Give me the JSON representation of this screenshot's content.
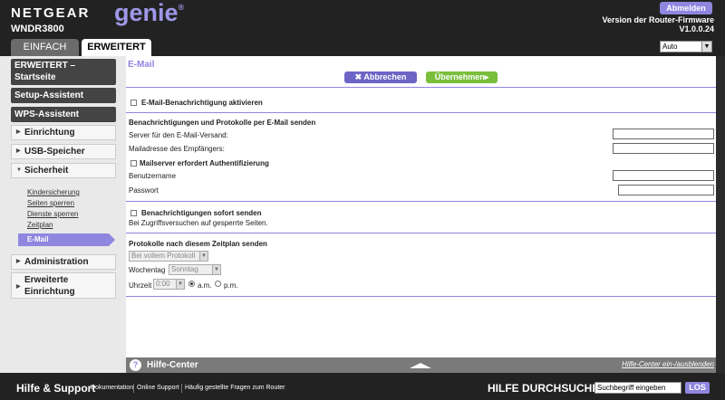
{
  "header": {
    "brand": "NETGEAR",
    "product": "genie",
    "trademark": "®",
    "model": "WNDR3800",
    "logout": "Abmelden",
    "firmware_label": "Version der Router-Firmware",
    "firmware_version": "V1.0.0.24",
    "tabs": [
      "EINFACH",
      "ERWEITERT"
    ],
    "language": "Auto"
  },
  "sidebar": {
    "home": [
      "ERWEITERT –",
      "Startseite"
    ],
    "setup": "Setup-Assistent",
    "wps": "WPS-Assistent",
    "sections": [
      "Einrichtung",
      "USB-Speicher",
      "Sicherheit"
    ],
    "security_items": [
      "Kindersicherung",
      "Seiten sperren",
      "Dienste sperren",
      "Zeitplan",
      "E-Mail"
    ],
    "admin": "Administration",
    "advanced_setup": [
      "Erweiterte",
      "Einrichtung"
    ]
  },
  "main": {
    "title": "E-Mail",
    "cancel": "Abbrechen",
    "apply": "Übernehmen",
    "enable_notify": "E-Mail-Benachrichtigung aktivieren",
    "send_section": "Benachrichtigungen und Protokolle per E-Mail senden",
    "server_label": "Server für den E-Mail-Versand:",
    "recipient_label": "Mailadresse des Empfängers:",
    "auth_label": "Mailserver erfordert Authentifizierung",
    "user_label": "Benutzername",
    "password_label": "Passwort",
    "immediate_label": "Benachrichtigungen sofort senden",
    "immediate_desc": "Bei Zugriffsversuchen auf gesperrte Seiten.",
    "schedule_section": "Protokolle nach diesem Zeitplan senden",
    "schedule_select": "Bei vollem Protokoll",
    "weekday_label": "Wochentag",
    "weekday_value": "Sonntag",
    "time_label": "Uhrzeit",
    "time_value": "0:00",
    "am": "a.m.",
    "pm": "p.m."
  },
  "help": {
    "title": "Hilfe-Center",
    "toggle": "Hilfe-Center ein-/ausblenden"
  },
  "footer": {
    "title": "Hilfe & Support",
    "links": [
      "Dokumentation",
      "Online Support",
      "Häufig gestellte Fragen zum Router"
    ],
    "search_title": "HILFE DURCHSUCHEN",
    "search_placeholder": "Suchbegriff eingeben",
    "search_button": "LOS"
  }
}
